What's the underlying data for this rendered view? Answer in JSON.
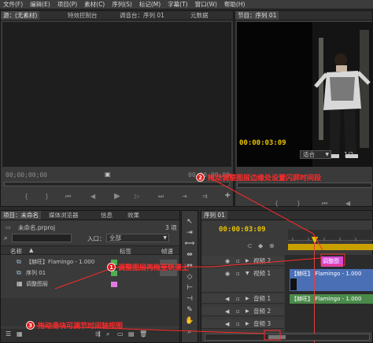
{
  "menu": [
    "文件(F)",
    "编辑(E)",
    "项目(P)",
    "素材(C)",
    "序列(S)",
    "标记(M)",
    "字幕(T)",
    "窗口(W)",
    "帮助(H)"
  ],
  "source": {
    "tabs": [
      "源：(无素材)",
      "特效控制台",
      "调音台：序列 01",
      "元数据"
    ],
    "tc_left": "00;00;00;00",
    "tc_right": "00;00;00;00"
  },
  "program": {
    "tab": "节目：序列 01",
    "tc": "00:00:03:09",
    "fit": "适合",
    "page": "1/2"
  },
  "project": {
    "tabs": [
      "项目：未命名",
      "媒体浏览器",
      "信息",
      "效果"
    ],
    "count": "3 项",
    "filename": "未命名.prproj",
    "entry_label": "入口：",
    "entry_value": "全部",
    "col_name": "名称",
    "col_label": "标签",
    "col_rate": "帧速",
    "items": [
      {
        "name": "【赫旺】Flamingo - 1.000",
        "color": "#4fae4f"
      },
      {
        "name": "序列 01",
        "color": "#4fae4f"
      },
      {
        "name": "调整图层",
        "color": "#e07be0"
      }
    ]
  },
  "timeline": {
    "tab": "序列 01",
    "tc": "00:00:03:09",
    "tracks": [
      {
        "name": "视频 2"
      },
      {
        "name": "视频 1"
      },
      {
        "name": "音频 1"
      },
      {
        "name": "音频 2"
      },
      {
        "name": "音频 3"
      }
    ],
    "clip_video": "【赫旺】 Flamingo - 1.000",
    "clip_audio": "【赫旺】 Flamingo - 1.000",
    "adjust_label": "调整图"
  },
  "annotations": {
    "a1_num": "1",
    "a1_text": "调整图层再拖至轨道上",
    "a2_num": "2",
    "a2_text": "拖动调整图层边缘处设置闪屏时间段",
    "a3_num": "3",
    "a3_text": "拖动滑块可调节时间轴视图"
  },
  "colors": {
    "accent": "#e8c300",
    "annotation": "#ff2a2a",
    "video_clip": "#4a6fb5",
    "audio_clip": "#4a8a4a",
    "adjust_clip": "#d94bd9"
  }
}
